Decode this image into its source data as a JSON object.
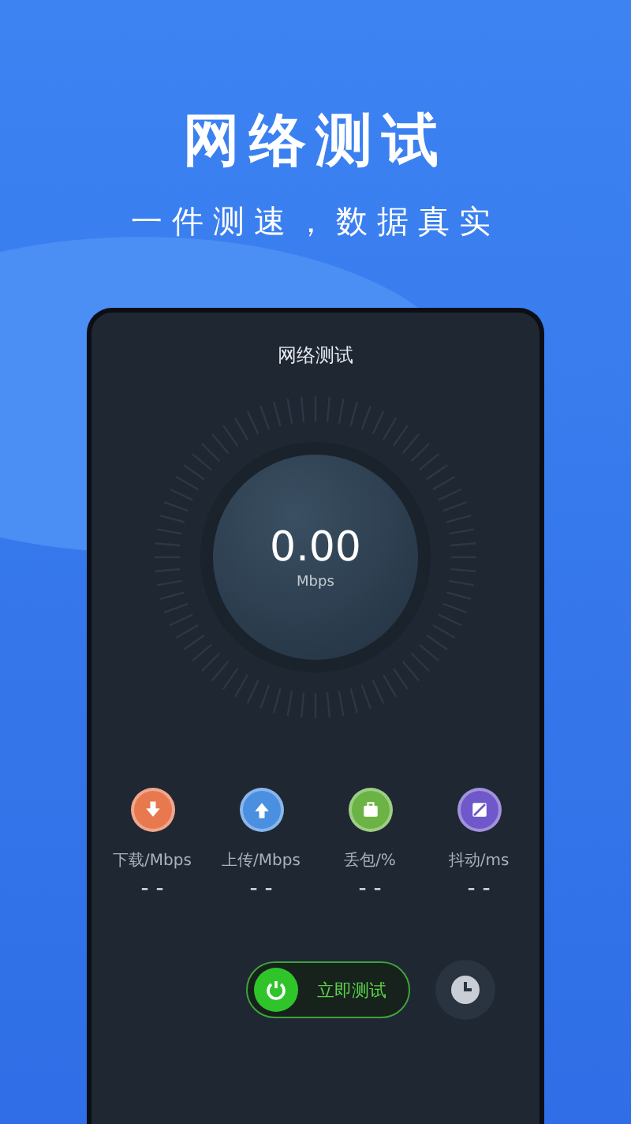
{
  "headline": "网络测试",
  "tagline": "一件测速，数据真实",
  "screen": {
    "title": "网络测试",
    "speed": {
      "value": "0.00",
      "unit": "Mbps"
    },
    "stats": [
      {
        "kind": "download",
        "label": "下载/Mbps",
        "value": "- -",
        "color": "#e8794f"
      },
      {
        "kind": "upload",
        "label": "上传/Mbps",
        "value": "- -",
        "color": "#4a8fe0"
      },
      {
        "kind": "loss",
        "label": "丢包/%",
        "value": "- -",
        "color": "#6bb344"
      },
      {
        "kind": "jitter",
        "label": "抖动/ms",
        "value": "- -",
        "color": "#6f58c9"
      }
    ],
    "start_button": {
      "label": "立即测试"
    }
  }
}
